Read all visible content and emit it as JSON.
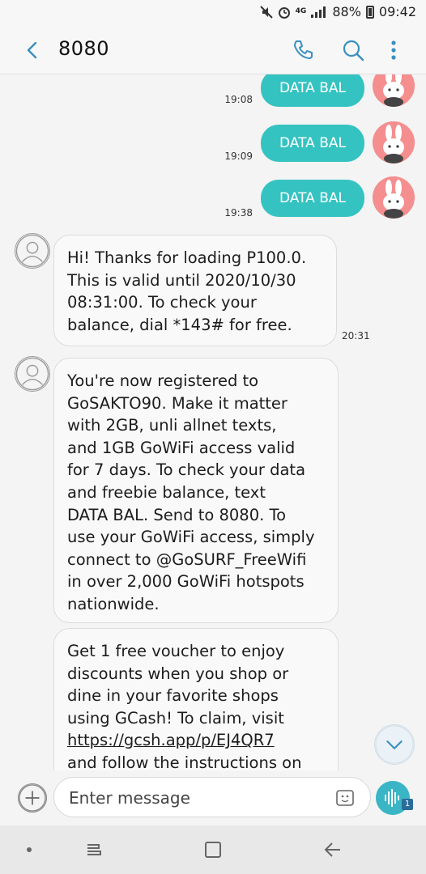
{
  "status_bar": {
    "network": "4G",
    "battery": "88%",
    "time": "09:42"
  },
  "header": {
    "title": "8080"
  },
  "sent_messages": [
    {
      "text": "DATA BAL",
      "time": "19:08"
    },
    {
      "text": "DATA BAL",
      "time": "19:09"
    },
    {
      "text": "DATA BAL",
      "time": "19:38"
    }
  ],
  "received_messages": [
    {
      "text": "Hi! Thanks for loading P100.0.\nThis is valid until 2020/10/30\n08:31:00. To check your\nbalance, dial *143# for free.",
      "time": "20:31"
    },
    {
      "text": "You're now registered to\nGoSAKTO90. Make it matter\nwith 2GB, unli allnet texts,\nand 1GB GoWiFi access valid\nfor 7 days. To check your data\nand freebie balance, text\nDATA BAL. Send to 8080. To\nuse your GoWiFi access, simply\nconnect to @GoSURF_FreeWifi\nin over 2,000 GoWiFi hotspots\nnationwide."
    },
    {
      "text_before": "Get 1 free voucher to enjoy\ndiscounts when you shop or\ndine in your favorite shops\nusing GCash! To claim, visit\n",
      "link": "https://gcsh.app/p/EJ4QR7",
      "text_after": "\nand follow the instructions on"
    }
  ],
  "composer": {
    "placeholder": "Enter message",
    "voice_badge": "1"
  },
  "icons": {
    "back": "chevron-left-icon",
    "call": "phone-icon",
    "search": "search-icon",
    "more": "more-vertical-icon",
    "attach": "plus-icon",
    "sticker": "sticker-icon",
    "voice": "voice-wave-icon",
    "scroll": "chevron-down-icon"
  },
  "colors": {
    "accent": "#35c3c1",
    "header_icons": "#3a8fc0",
    "bubble_sent": "#35c3c1",
    "bubble_received": "#f9f9f9"
  }
}
